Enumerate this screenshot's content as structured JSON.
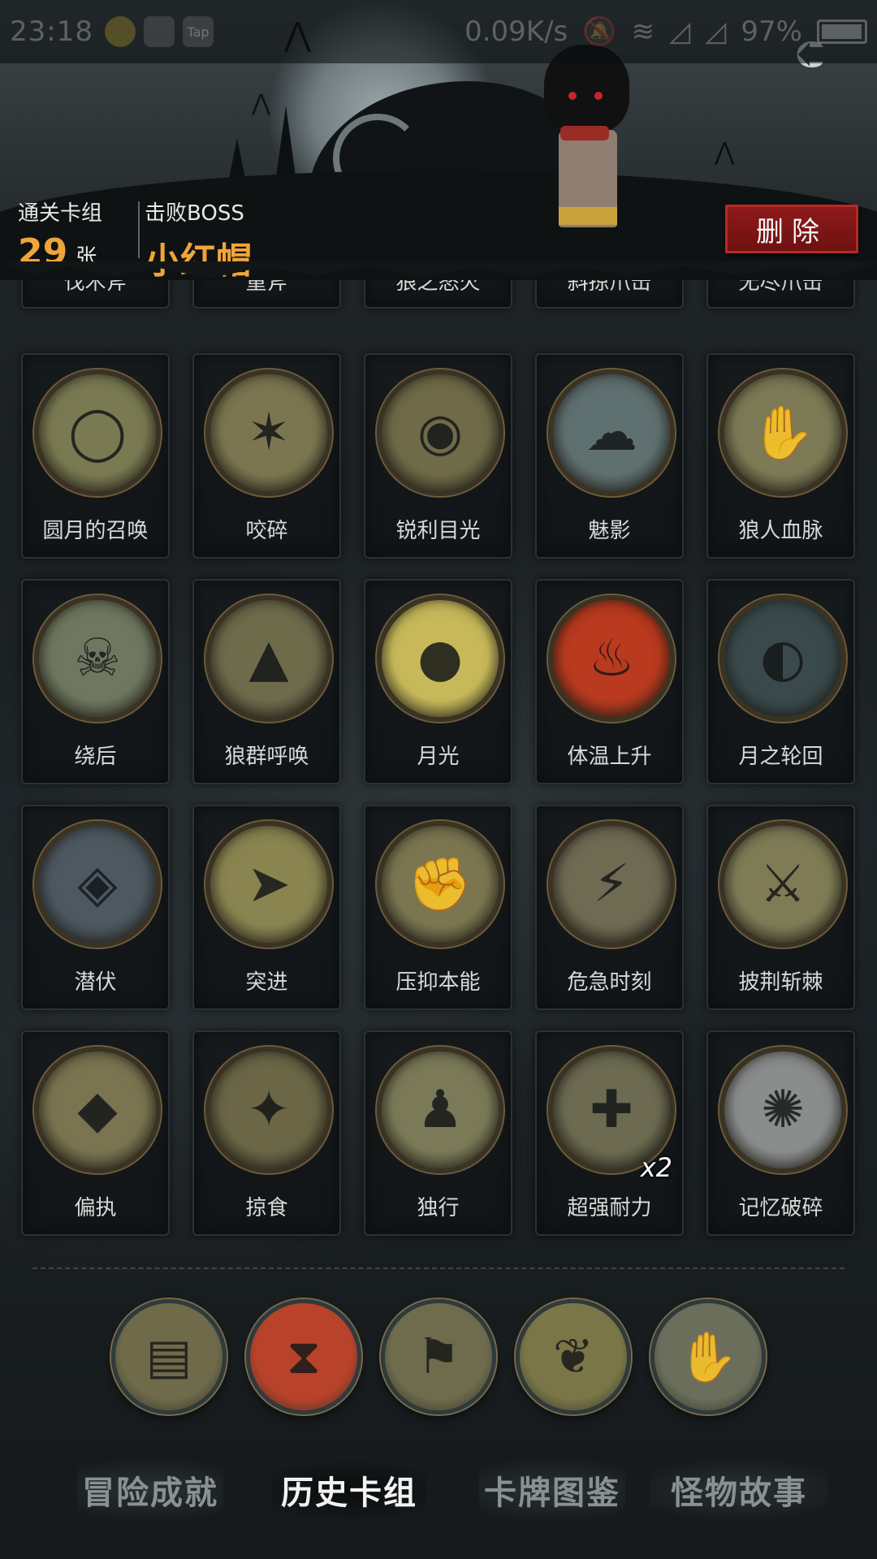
{
  "status_bar": {
    "time": "23:18",
    "app_icon_label": "Tap",
    "net_speed": "0.09K/s",
    "battery": "97%"
  },
  "header": {
    "clear_deck_label": "通关卡组",
    "clear_deck_count": "29",
    "clear_deck_unit": "张",
    "boss_label": "击败BOSS",
    "boss_name": "小红帽",
    "delete_label": "删除"
  },
  "partial_row": [
    "伐木斧",
    "重斧",
    "狼之怒火",
    "斜掠爪击",
    "无尽爪击"
  ],
  "cards": [
    {
      "name": "圆月的召唤",
      "icon": "full-moon-forest-icon",
      "bg": "#7a7a52"
    },
    {
      "name": "咬碎",
      "icon": "werewolf-bite-icon",
      "bg": "#7b7650"
    },
    {
      "name": "锐利目光",
      "icon": "wolf-glare-icon",
      "bg": "#6f6a48"
    },
    {
      "name": "魅影",
      "icon": "phantom-wolf-icon",
      "bg": "#5f7070"
    },
    {
      "name": "狼人血脉",
      "icon": "claw-hand-icon",
      "bg": "#7d7a55"
    },
    {
      "name": "绕后",
      "icon": "skeleton-ambush-icon",
      "bg": "#6f7760"
    },
    {
      "name": "狼群呼唤",
      "icon": "wolf-pack-icon",
      "bg": "#6e6b4b"
    },
    {
      "name": "月光",
      "icon": "moon-howl-icon",
      "bg": "#c7b95a"
    },
    {
      "name": "体温上升",
      "icon": "fire-werewolf-icon",
      "bg": "#b93a1e"
    },
    {
      "name": "月之轮回",
      "icon": "moon-phases-icon",
      "bg": "#3a4a4c"
    },
    {
      "name": "潜伏",
      "icon": "lurking-wolf-icon",
      "bg": "#4d5860"
    },
    {
      "name": "突进",
      "icon": "dash-wolf-icon",
      "bg": "#8a8450"
    },
    {
      "name": "压抑本能",
      "icon": "suppress-instinct-icon",
      "bg": "#7b7650"
    },
    {
      "name": "危急时刻",
      "icon": "crisis-moment-icon",
      "bg": "#6f6a52"
    },
    {
      "name": "披荆斩棘",
      "icon": "axe-thorns-icon",
      "bg": "#7e7b55"
    },
    {
      "name": "偏执",
      "icon": "bear-wolf-icon",
      "bg": "#7a7450"
    },
    {
      "name": "掠食",
      "icon": "predator-icon",
      "bg": "#6a6646"
    },
    {
      "name": "独行",
      "icon": "lone-walker-icon",
      "bg": "#7b7a58"
    },
    {
      "name": "超强耐力",
      "icon": "stamina-icon",
      "bg": "#6c6a50",
      "count": "x2"
    },
    {
      "name": "记忆破碎",
      "icon": "shattered-memory-icon",
      "bg": "#8a8d8c"
    }
  ],
  "tools": [
    {
      "icon": "card-deck-skull-icon",
      "bg": "#6f6a4a"
    },
    {
      "icon": "hourglass-skull-icon",
      "bg": "#b8432a"
    },
    {
      "icon": "signpost-icon",
      "bg": "#6e6c4c"
    },
    {
      "icon": "phoenix-feather-icon",
      "bg": "#7a7648"
    },
    {
      "icon": "hand-cards-icon",
      "bg": "#6b6e5a"
    }
  ],
  "nav": {
    "tabs": [
      "冒险成就",
      "历史卡组",
      "卡牌图鉴",
      "怪物故事"
    ],
    "active_index": 1
  }
}
